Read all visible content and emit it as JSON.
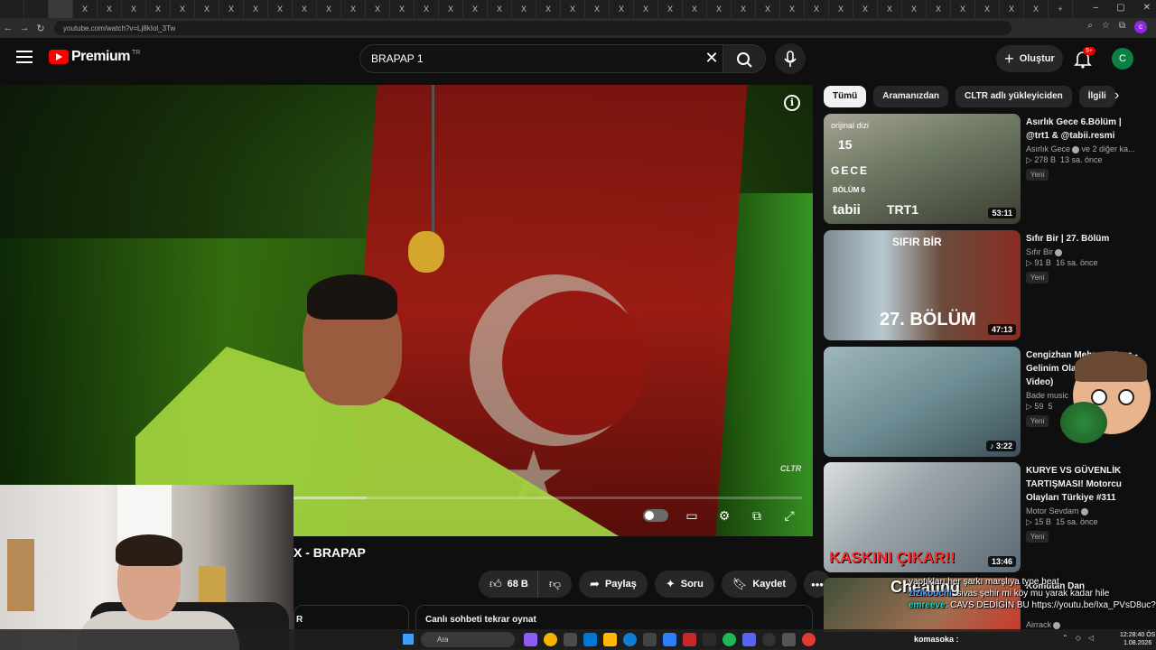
{
  "browser": {
    "url": "youtube.com/watch?v=Lj8kIol_3Tw",
    "tab_close": "X",
    "new_tab": "+"
  },
  "header": {
    "logo_text": "Premium",
    "country_code": "TR",
    "search_query": "BRAPAP 1",
    "create_label": "Oluştur",
    "notification_badge": "9+",
    "avatar_letter": "C"
  },
  "player": {
    "watermark": "CLTR",
    "progress_fraction": 0.45
  },
  "video": {
    "title": "X - BRAPAP",
    "like_count": "68 B",
    "share_label": "Paylaş",
    "ask_label": "Soru",
    "save_label": "Kaydet",
    "left_panel_fragment": "R",
    "live_chat_replay": "Canlı sohbeti tekrar oynat"
  },
  "chips": [
    {
      "label": "Tümü",
      "active": true
    },
    {
      "label": "Aramanızdan",
      "active": false
    },
    {
      "label": "CLTR adlı yükleyiciden",
      "active": false
    },
    {
      "label": "İlgili",
      "active": false
    }
  ],
  "recommendations": [
    {
      "title": "Asırlık Gece 6.Bölüm | @trt1 & @tabii.resmi",
      "channel": "Asırlık Gece",
      "channel_extra": "ve 2 diğer ka...",
      "views": "278 B",
      "age": "13 sa. önce",
      "tag": "Yeni",
      "duration": "53:11",
      "thumb_texts": [
        "orijinal dizi",
        "15",
        "GECE",
        "BÖLÜM 6",
        "tabii",
        "TRT1"
      ]
    },
    {
      "title": "Sıfır Bir | 27. Bölüm",
      "channel": "Sıfır Bir",
      "views": "91 B",
      "age": "16 sa. önce",
      "tag": "Yeni",
      "duration": "47:13",
      "thumb_texts": [
        "SIFIR BİR",
        "27. BÖLÜM"
      ]
    },
    {
      "title": "Cengizhan Mehmet Kaya - Gelinim Olas... Music Video)",
      "channel": "Bade music",
      "views": "59",
      "age": "5",
      "tag": "Yeni",
      "duration": "3:22"
    },
    {
      "title": "KURYE VS GÜVENLİK TARTIŞMASI! Motorcu Olayları Türkiye #311",
      "channel": "Motor Sevdam",
      "views": "15 B",
      "age": "15 sa. önce",
      "tag": "Yeni",
      "duration": "13:46",
      "thumb_texts": [
        "KASKINI ÇIKAR!!"
      ]
    },
    {
      "title": "Komutan Dan",
      "channel": "Airrack"
    }
  ],
  "overlay": {
    "cheating": "Cheating",
    "chat": [
      {
        "user": "",
        "msg": "yaptıkları her şarkı marşlıya type beat",
        "color": "purple"
      },
      {
        "user": "zizikoochi",
        "msg": ": sivas şehir mi köy mu yarak kadar hile",
        "color": "blue"
      },
      {
        "user": "emreeve",
        "msg": ": CAVS DEDİGİN BU https://youtu.be/Ixa_PVsD8uc?si=jHZfADKIAXa_tbGR",
        "color": "teal"
      }
    ]
  },
  "taskbar": {
    "search_placeholder": "Ara",
    "now_playing": "komasoka :",
    "time": "12:28:40 ÖS",
    "date": "1.08.2026"
  },
  "colors": {
    "yt_red": "#ff0000",
    "avatar": "#0b8043",
    "badge": "#e40000"
  }
}
